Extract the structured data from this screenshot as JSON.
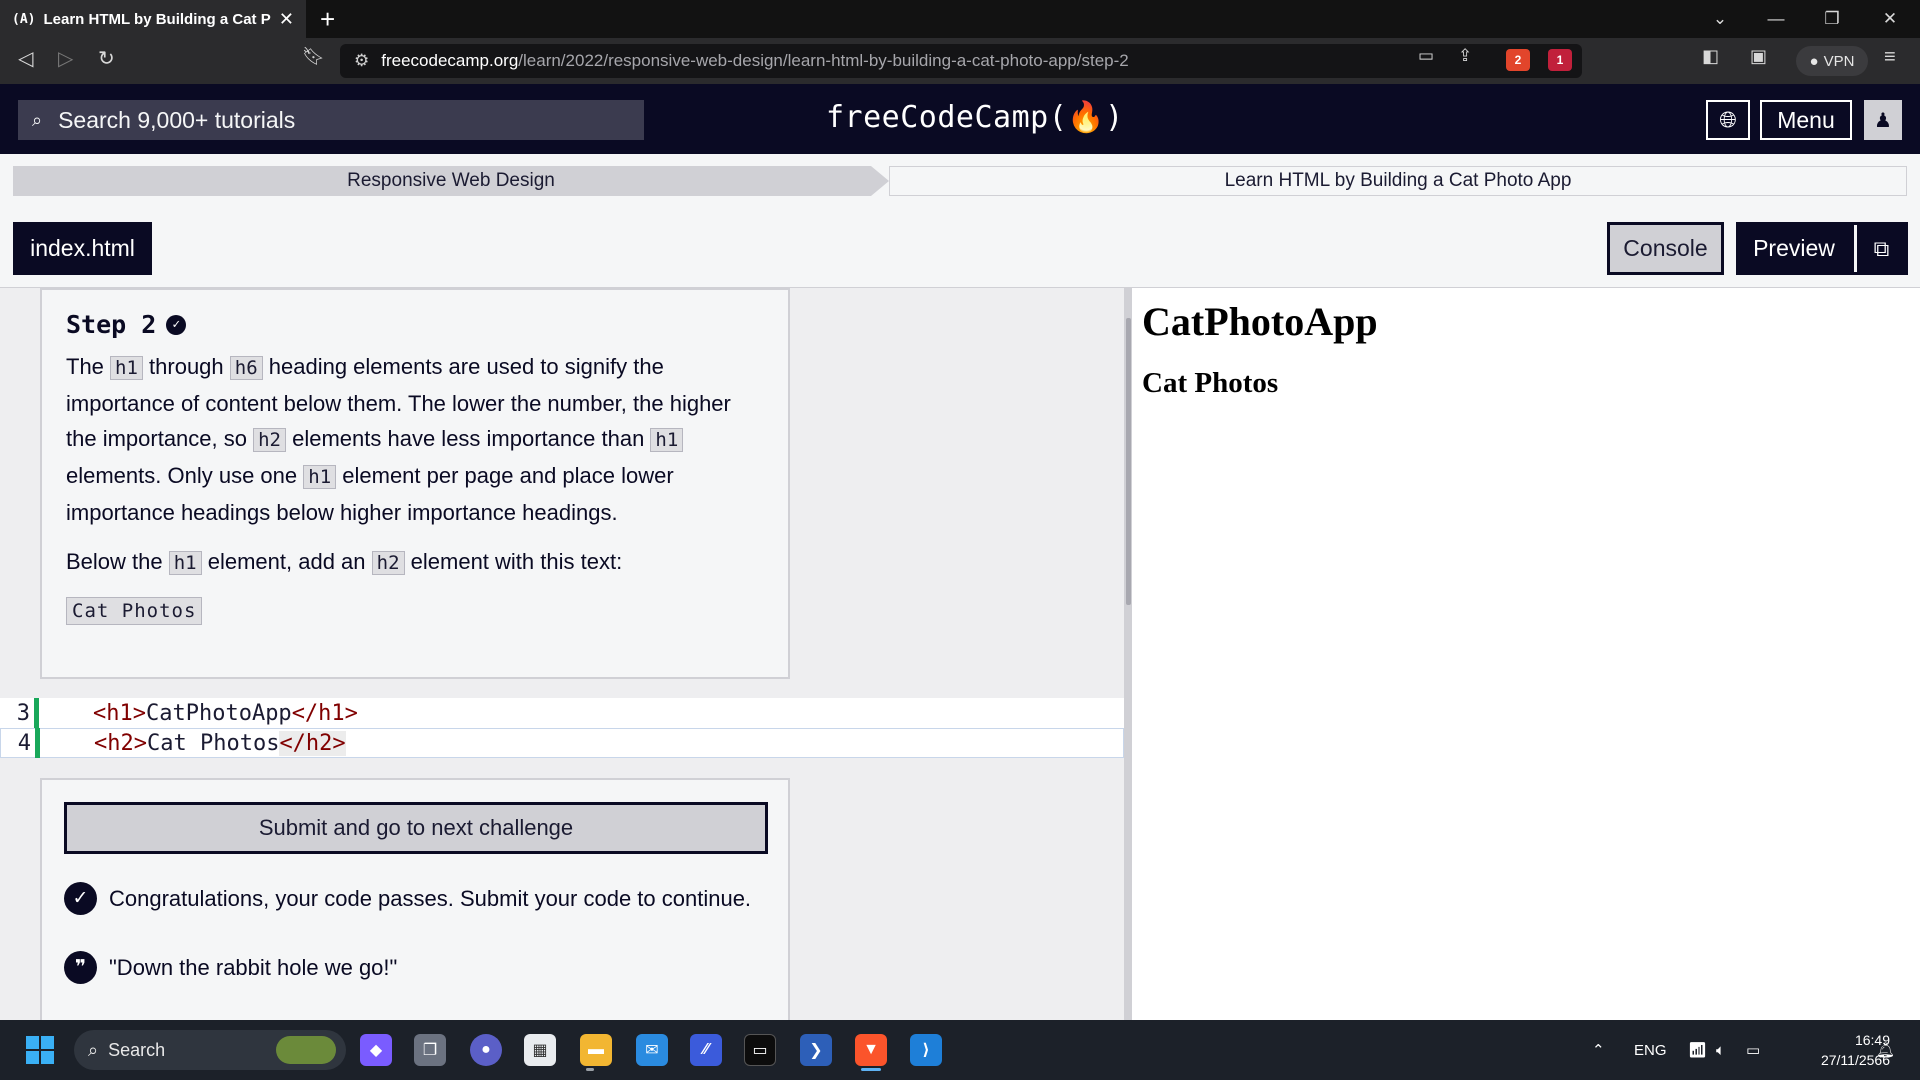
{
  "browser": {
    "tab_title": "Learn HTML by Building a Cat Photo App",
    "tab_favicon": "(A)",
    "url_host": "freecodecamp.org",
    "url_path": "/learn/2022/responsive-web-design/learn-html-by-building-a-cat-photo-app/step-2",
    "brave_badge": "2",
    "alert_badge": "1",
    "vpn_label": "VPN"
  },
  "navbar": {
    "search_placeholder": "Search 9,000+ tutorials",
    "logo": "freeCodeCamp(🔥)",
    "menu_label": "Menu"
  },
  "breadcrumb": {
    "superblock": "Responsive Web Design",
    "block": "Learn HTML by Building a Cat Photo App"
  },
  "editor_tabs": {
    "file": "index.html",
    "console": "Console",
    "preview": "Preview"
  },
  "instructions": {
    "title": "Step 2",
    "p1": {
      "t1": "The ",
      "c1": "h1",
      "t2": " through ",
      "c2": "h6",
      "t3": " heading elements are used to signify the importance of content below them. The lower the number, the higher the importance, so ",
      "c3": "h2",
      "t4": " elements have less importance than ",
      "c4": "h1",
      "t5": " elements. Only use one ",
      "c5": "h1",
      "t6": " element per page and place lower importance headings below higher importance headings."
    },
    "p2": {
      "t1": "Below the ",
      "c1": "h1",
      "t2": " element, add an ",
      "c2": "h2",
      "t3": " element with this text:"
    },
    "code_block": "Cat Photos"
  },
  "editor": {
    "lines": [
      {
        "num": "3",
        "open": "<h1>",
        "text": "CatPhotoApp",
        "close": "</h1>"
      },
      {
        "num": "4",
        "open": "<h2>",
        "text": "Cat Photos",
        "close": "</h2>"
      }
    ]
  },
  "results": {
    "submit_label": "Submit and go to next challenge",
    "success_msg": "Congratulations, your code passes. Submit your code to continue.",
    "quote": "\"Down the rabbit hole we go!\""
  },
  "preview": {
    "h1": "CatPhotoApp",
    "h2": "Cat Photos"
  },
  "taskbar": {
    "search_label": "Search",
    "language": "ENG",
    "time": "16:49",
    "date": "27/11/2566"
  },
  "colors": {
    "fcc_dark": "#0a0a23",
    "gutter_green": "#19a85a",
    "tag_color": "#800000"
  }
}
